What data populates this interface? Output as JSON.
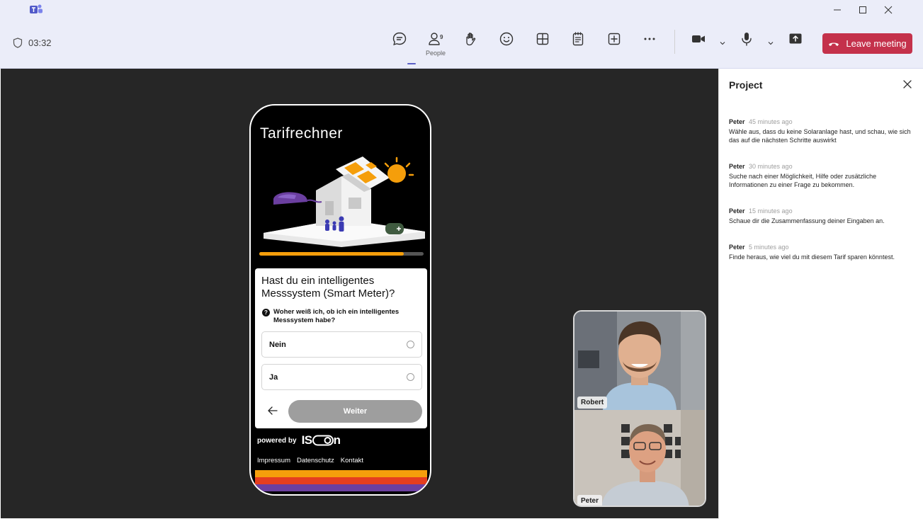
{
  "window": {
    "timer": "03:32"
  },
  "toolbar": {
    "people_label": "People",
    "people_count": "9",
    "leave_label": "Leave meeting",
    "colors": {
      "accent": "#5b5fc7",
      "leave": "#c4314b"
    }
  },
  "app": {
    "title": "Tarifrechner",
    "progress": 0.88,
    "question": "Hast du ein intelligentes Messsystem (Smart Meter)?",
    "hint": "Woher weiß ich, ob ich ein intelligentes Messsystem habe?",
    "options": [
      {
        "label": "Nein"
      },
      {
        "label": "Ja"
      }
    ],
    "next_label": "Weiter",
    "powered_by": "powered by",
    "brand_prefix": "IS",
    "brand_suffix": "n",
    "footer_links": [
      "Impressum",
      "Datenschutz",
      "Kontakt"
    ],
    "colors": {
      "progress": "#f59e0b",
      "stripe1": "#f59e0b",
      "stripe2": "#e53e1f",
      "stripe3": "#6b3fa0"
    }
  },
  "participants": [
    {
      "name": "Robert"
    },
    {
      "name": "Peter"
    }
  ],
  "panel": {
    "title": "Project",
    "messages": [
      {
        "author": "Peter",
        "time": "45 minutes ago",
        "text": "Wähle aus, dass du keine Solaranlage hast, und schau, wie sich das auf die nächsten Schritte auswirkt"
      },
      {
        "author": "Peter",
        "time": "30 minutes ago",
        "text": "Suche nach einer Möglichkeit, Hilfe oder zusätzliche Informationen zu einer Frage zu bekommen."
      },
      {
        "author": "Peter",
        "time": "15 minutes ago",
        "text": "Schaue dir die Zusammenfassung deiner Eingaben an."
      },
      {
        "author": "Peter",
        "time": "5 minutes ago",
        "text": "Finde heraus, wie viel du mit diesem Tarif sparen könntest."
      }
    ]
  }
}
